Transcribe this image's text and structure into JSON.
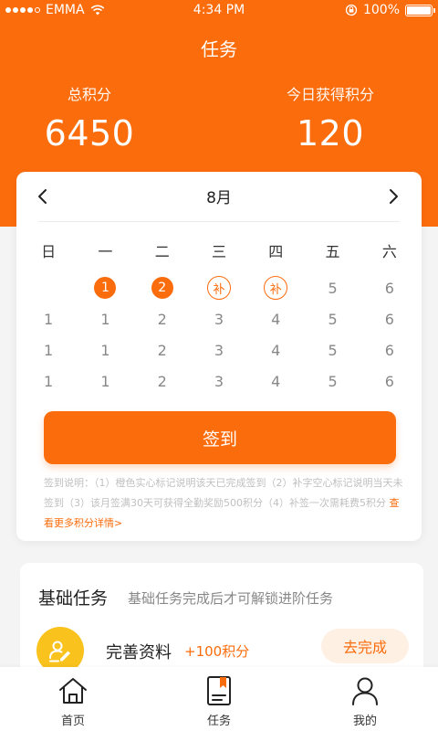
{
  "status_bar": {
    "carrier": "EMMA",
    "time": "4:34 PM",
    "battery": "100%",
    "battery_level": 1.0,
    "signal_bars_filled": 4,
    "signal_bars_total": 5
  },
  "header": {
    "title": "任务",
    "total_points_label": "总积分",
    "total_points_value": "6450",
    "today_points_label": "今日获得积分",
    "today_points_value": "120"
  },
  "calendar": {
    "month": "8月",
    "weekdays": [
      "日",
      "一",
      "二",
      "三",
      "四",
      "五",
      "六"
    ],
    "rows": [
      [
        {
          "text": "",
          "state": "none"
        },
        {
          "text": "1",
          "state": "done"
        },
        {
          "text": "2",
          "state": "done"
        },
        {
          "text": "补",
          "state": "makeup"
        },
        {
          "text": "补",
          "state": "makeup"
        },
        {
          "text": "5",
          "state": "none"
        },
        {
          "text": "6",
          "state": "none"
        }
      ],
      [
        {
          "text": "1",
          "state": "none"
        },
        {
          "text": "1",
          "state": "none"
        },
        {
          "text": "2",
          "state": "none"
        },
        {
          "text": "3",
          "state": "none"
        },
        {
          "text": "4",
          "state": "none"
        },
        {
          "text": "5",
          "state": "none"
        },
        {
          "text": "6",
          "state": "none"
        }
      ],
      [
        {
          "text": "1",
          "state": "none"
        },
        {
          "text": "1",
          "state": "none"
        },
        {
          "text": "2",
          "state": "none"
        },
        {
          "text": "3",
          "state": "none"
        },
        {
          "text": "4",
          "state": "none"
        },
        {
          "text": "5",
          "state": "none"
        },
        {
          "text": "6",
          "state": "none"
        }
      ],
      [
        {
          "text": "1",
          "state": "none"
        },
        {
          "text": "1",
          "state": "none"
        },
        {
          "text": "2",
          "state": "none"
        },
        {
          "text": "3",
          "state": "none"
        },
        {
          "text": "4",
          "state": "none"
        },
        {
          "text": "5",
          "state": "none"
        },
        {
          "text": "6",
          "state": "none"
        }
      ]
    ],
    "signin_label": "签到",
    "note_text": "签到说明：（1）橙色实心标记说明该天已完成签到（2）补字空心标记说明当天未签到（3）该月签满30天可获得全勤奖励500积分（4）补签一次需耗费5积分 ",
    "note_link": "查看更多积分详情>"
  },
  "tasks": {
    "heading": "基础任务",
    "subheading": "基础任务完成后才可解锁进阶任务",
    "items": [
      {
        "name": "完善资料",
        "points": "+100积分",
        "action": "去完成",
        "icon": "edit-profile-icon"
      }
    ]
  },
  "tab_bar": {
    "items": [
      {
        "label": "首页",
        "icon": "home-icon"
      },
      {
        "label": "任务",
        "icon": "task-icon"
      },
      {
        "label": "我的",
        "icon": "profile-icon"
      }
    ]
  },
  "colors": {
    "accent": "#fb6c0c",
    "task_icon_bg": "#f9c21d"
  }
}
